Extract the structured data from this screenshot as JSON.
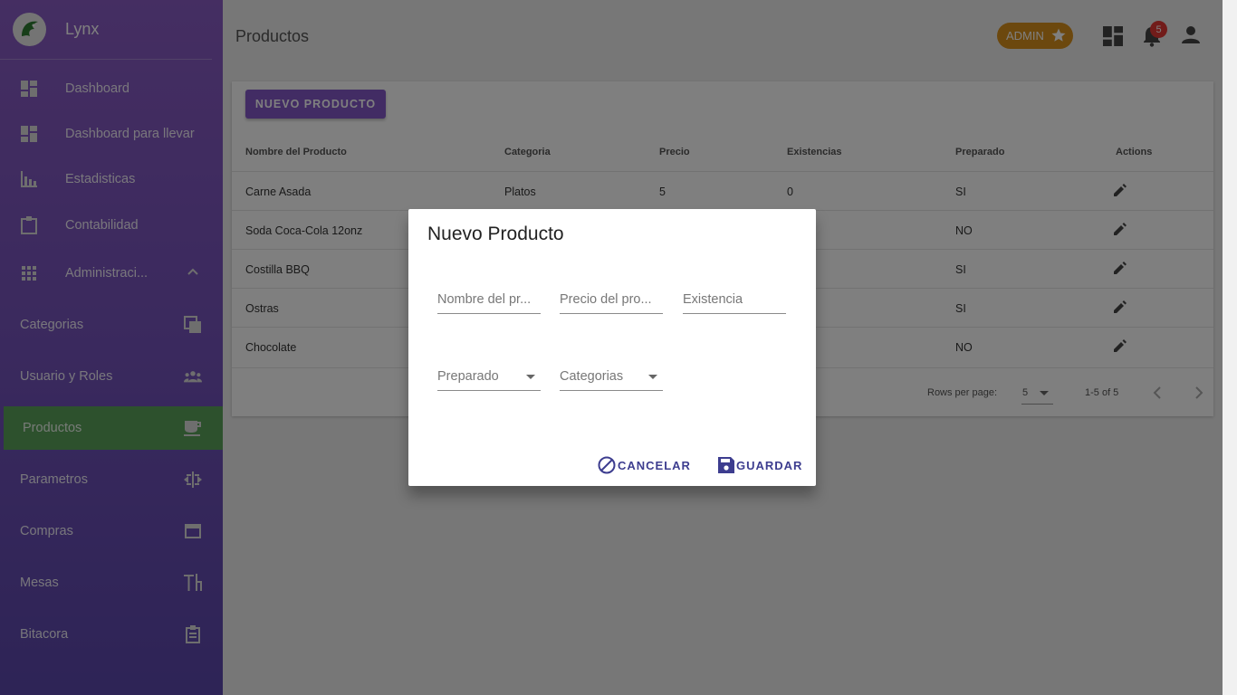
{
  "app": {
    "name": "Lynx"
  },
  "sidebar": {
    "items": [
      {
        "label": "Dashboard",
        "icon": "dashboard-icon"
      },
      {
        "label": "Dashboard para llevar",
        "icon": "dashboard-icon"
      },
      {
        "label": "Estadisticas",
        "icon": "bar-chart-icon"
      },
      {
        "label": "Contabilidad",
        "icon": "clipboard-icon"
      },
      {
        "label": "Administraci...",
        "icon": "apps-icon"
      }
    ],
    "sub_items": [
      {
        "label": "Categorias",
        "icon": "library-icon"
      },
      {
        "label": "Usuario y Roles",
        "icon": "people-icon"
      },
      {
        "label": "Productos",
        "icon": "cup-icon"
      },
      {
        "label": "Parametros",
        "icon": "settings-ethernet-icon"
      },
      {
        "label": "Compras",
        "icon": "window-icon"
      },
      {
        "label": "Mesas",
        "icon": "table-icon"
      },
      {
        "label": "Bitacora",
        "icon": "log-icon"
      }
    ],
    "active_color": "#5aa35a"
  },
  "header": {
    "title": "Productos",
    "role_label": "ADMIN",
    "notification_count": "5"
  },
  "table": {
    "new_button_label": "NUEVO PRODUCTO",
    "columns": [
      "Nombre del Producto",
      "Categoria",
      "Precio",
      "Existencias",
      "Preparado",
      "Actions"
    ],
    "rows": [
      [
        "Carne Asada",
        "Platos",
        "5",
        "0",
        "SI"
      ],
      [
        "Soda Coca-Cola 12onz",
        "",
        "",
        "",
        "NO"
      ],
      [
        "Costilla BBQ",
        "",
        "",
        "",
        "SI"
      ],
      [
        "Ostras",
        "",
        "",
        "",
        "SI"
      ],
      [
        "Chocolate",
        "",
        "",
        "",
        "NO"
      ]
    ],
    "pagination": {
      "rows_per_page_label": "Rows per page:",
      "rows_per_page": "5",
      "range": "1-5 of 5"
    }
  },
  "dialog": {
    "title": "Nuevo Producto",
    "fields": {
      "name_placeholder": "Nombre del pr...",
      "price_placeholder": "Precio del pro...",
      "stock_placeholder": "Existencia",
      "prepared_label": "Preparado",
      "category_label": "Categorias"
    },
    "cancel_label": "CANCELAR",
    "save_label": "GUARDAR"
  },
  "colors": {
    "accent": "#8559c8",
    "admin_chip": "#d8901c",
    "badge": "#e53935",
    "dialog_button": "#3d3d8f"
  }
}
